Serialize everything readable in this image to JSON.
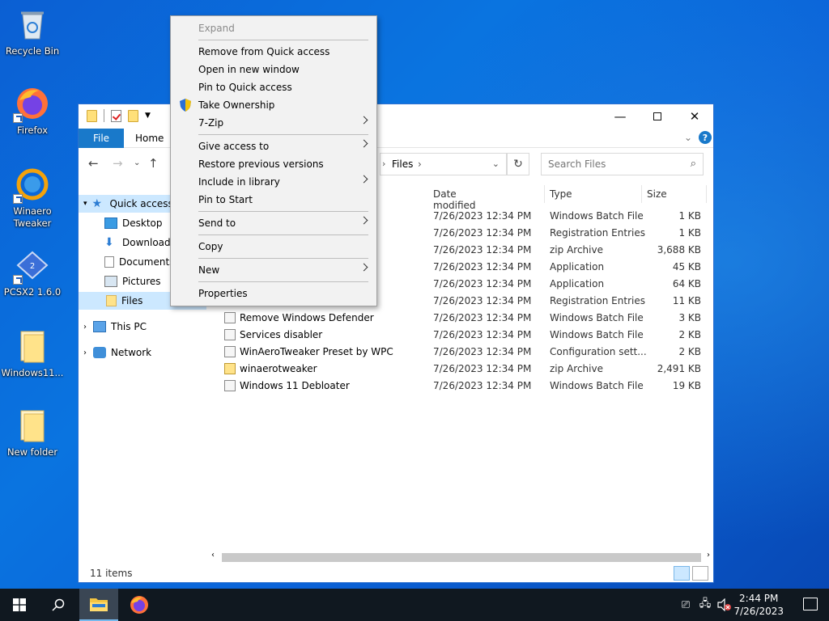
{
  "desktop": {
    "icons": [
      {
        "label": "Recycle Bin",
        "icon": "recycle-bin-icon"
      },
      {
        "label": "Firefox",
        "icon": "firefox-icon"
      },
      {
        "label": "Winaero Tweaker",
        "icon": "winaero-icon"
      },
      {
        "label": "PCSX2 1.6.0",
        "icon": "pcsx2-icon"
      },
      {
        "label": "Windows11...",
        "icon": "folder-icon"
      },
      {
        "label": "New folder",
        "icon": "folder-icon"
      }
    ]
  },
  "explorer": {
    "ribbon": {
      "file_tab": "File",
      "home_tab": "Home",
      "help": "?"
    },
    "address": {
      "current": "Files",
      "sep": "›"
    },
    "search": {
      "placeholder": "Search Files"
    },
    "nav": {
      "quick_access": "Quick access",
      "desktop": "Desktop",
      "downloads": "Downloads",
      "documents": "Documents",
      "pictures": "Pictures",
      "files": "Files",
      "this_pc": "This PC",
      "network": "Network"
    },
    "columns": {
      "date": "Date modified",
      "type": "Type",
      "size": "Size"
    },
    "rows": [
      {
        "name": "",
        "date": "7/26/2023 12:34 PM",
        "type": "Windows Batch File",
        "size": "1 KB"
      },
      {
        "name": "",
        "date": "7/26/2023 12:34 PM",
        "type": "Registration Entries",
        "size": "1 KB"
      },
      {
        "name": "",
        "date": "7/26/2023 12:34 PM",
        "type": "zip Archive",
        "size": "3,688 KB"
      },
      {
        "name": "",
        "date": "7/26/2023 12:34 PM",
        "type": "Application",
        "size": "45 KB"
      },
      {
        "name": "",
        "date": "7/26/2023 12:34 PM",
        "type": "Application",
        "size": "64 KB"
      },
      {
        "name": "",
        "date": "7/26/2023 12:34 PM",
        "type": "Registration Entries",
        "size": "11 KB"
      },
      {
        "name": "Remove Windows Defender",
        "date": "7/26/2023 12:34 PM",
        "type": "Windows Batch File",
        "size": "3 KB"
      },
      {
        "name": "Services disabler",
        "date": "7/26/2023 12:34 PM",
        "type": "Windows Batch File",
        "size": "2 KB"
      },
      {
        "name": "WinAeroTweaker Preset by WPC",
        "date": "7/26/2023 12:34 PM",
        "type": "Configuration sett...",
        "size": "2 KB"
      },
      {
        "name": "winaerotweaker",
        "date": "7/26/2023 12:34 PM",
        "type": "zip Archive",
        "size": "2,491 KB"
      },
      {
        "name": "Windows 11 Debloater",
        "date": "7/26/2023 12:34 PM",
        "type": "Windows Batch File",
        "size": "19 KB"
      }
    ],
    "status": "11 items"
  },
  "context_menu": {
    "expand": "Expand",
    "remove_quick": "Remove from Quick access",
    "open_new": "Open in new window",
    "pin_quick": "Pin to Quick access",
    "take_ownership": "Take Ownership",
    "seven_zip": "7-Zip",
    "give_access": "Give access to",
    "restore": "Restore previous versions",
    "include_library": "Include in library",
    "pin_start": "Pin to Start",
    "send_to": "Send to",
    "copy": "Copy",
    "new": "New",
    "properties": "Properties"
  },
  "taskbar": {
    "time": "2:44 PM",
    "date": "7/26/2023"
  },
  "colors": {
    "accent": "#1979ca",
    "selection": "#cce8ff",
    "taskbar": "#101820"
  }
}
